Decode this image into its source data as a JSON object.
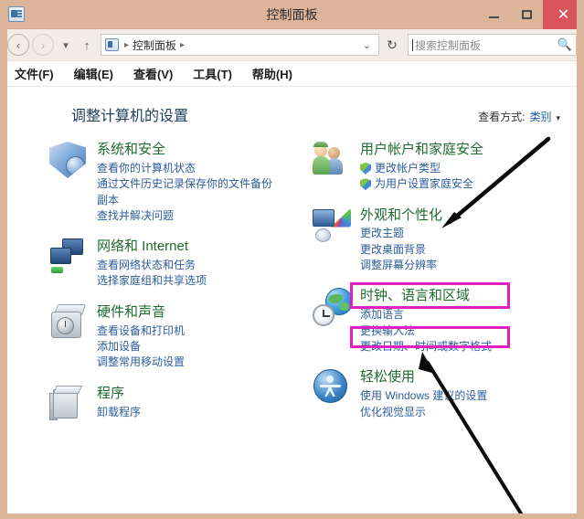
{
  "window": {
    "title": "控制面板",
    "app_icon": "control-panel-icon",
    "buttons": {
      "minimize": "–",
      "maximize": "□",
      "close": "✕"
    }
  },
  "navbar": {
    "back": "‹",
    "forward": "›",
    "recent_caret": "▾",
    "up": "↑",
    "breadcrumb": {
      "icon": "control-panel-icon",
      "sep1": "▸",
      "item": "控制面板",
      "sep2": "▸"
    },
    "address_dropdown": "⌄",
    "refresh": "↻",
    "search": {
      "placeholder": "搜索控制面板",
      "icon": "🔍"
    }
  },
  "menubar": {
    "items": [
      {
        "label": "文件(F)"
      },
      {
        "label": "编辑(E)"
      },
      {
        "label": "查看(V)"
      },
      {
        "label": "工具(T)"
      },
      {
        "label": "帮助(H)"
      }
    ]
  },
  "content": {
    "page_title": "调整计算机的设置",
    "view_by": {
      "label": "查看方式:",
      "value": "类别",
      "caret": "▾"
    },
    "left_column": [
      {
        "icon": "system-security-shield-icon",
        "title": "系统和安全",
        "links": [
          {
            "text": "查看你的计算机状态",
            "shield": false
          },
          {
            "text": "通过文件历史记录保存你的文件备份副本",
            "shield": false
          },
          {
            "text": "查找并解决问题",
            "shield": false
          }
        ]
      },
      {
        "icon": "network-internet-icon",
        "title": "网络和 Internet",
        "links": [
          {
            "text": "查看网络状态和任务",
            "shield": false
          },
          {
            "text": "选择家庭组和共享选项",
            "shield": false
          }
        ]
      },
      {
        "icon": "hardware-sound-icon",
        "title": "硬件和声音",
        "links": [
          {
            "text": "查看设备和打印机",
            "shield": false
          },
          {
            "text": "添加设备",
            "shield": false
          },
          {
            "text": "调整常用移动设置",
            "shield": false
          }
        ]
      },
      {
        "icon": "programs-icon",
        "title": "程序",
        "links": [
          {
            "text": "卸载程序",
            "shield": false
          }
        ]
      }
    ],
    "right_column": [
      {
        "icon": "user-accounts-family-safety-icon",
        "title": "用户帐户和家庭安全",
        "links": [
          {
            "text": "更改帐户类型",
            "shield": true
          },
          {
            "text": "为用户设置家庭安全",
            "shield": true
          }
        ]
      },
      {
        "icon": "appearance-personalization-icon",
        "title": "外观和个性化",
        "links": [
          {
            "text": "更改主题",
            "shield": false
          },
          {
            "text": "更改桌面背景",
            "shield": false
          },
          {
            "text": "调整屏幕分辨率",
            "shield": false
          }
        ]
      },
      {
        "icon": "clock-language-region-icon",
        "title": "时钟、语言和区域",
        "links": [
          {
            "text": "添加语言",
            "shield": false
          },
          {
            "text": "更换输入法",
            "shield": false
          },
          {
            "text": "更改日期、时间或数字格式",
            "shield": false
          }
        ]
      },
      {
        "icon": "ease-of-access-icon",
        "title": "轻松使用",
        "links": [
          {
            "text": "使用 Windows 建议的设置",
            "shield": false
          },
          {
            "text": "优化视觉显示",
            "shield": false
          }
        ]
      }
    ]
  },
  "annotations": {
    "highlight_color": "#e020c0",
    "arrow_color": "#000000",
    "highlights": [
      {
        "name": "clock-language-region-highlight",
        "target": "时钟、语言和区域"
      },
      {
        "name": "change-input-method-highlight",
        "target": "更换输入法"
      }
    ],
    "arrows": [
      {
        "name": "arrow-to-appearance",
        "points_to": "外观和个性化"
      },
      {
        "name": "arrow-to-change-input-method",
        "points_to": "更换输入法"
      }
    ]
  },
  "colors": {
    "titlebar": "#dcb49a",
    "close_button": "#d8555a",
    "category_title": "#1f6b2f",
    "link": "#2c5d9b",
    "page_title": "#1f3d5c"
  }
}
